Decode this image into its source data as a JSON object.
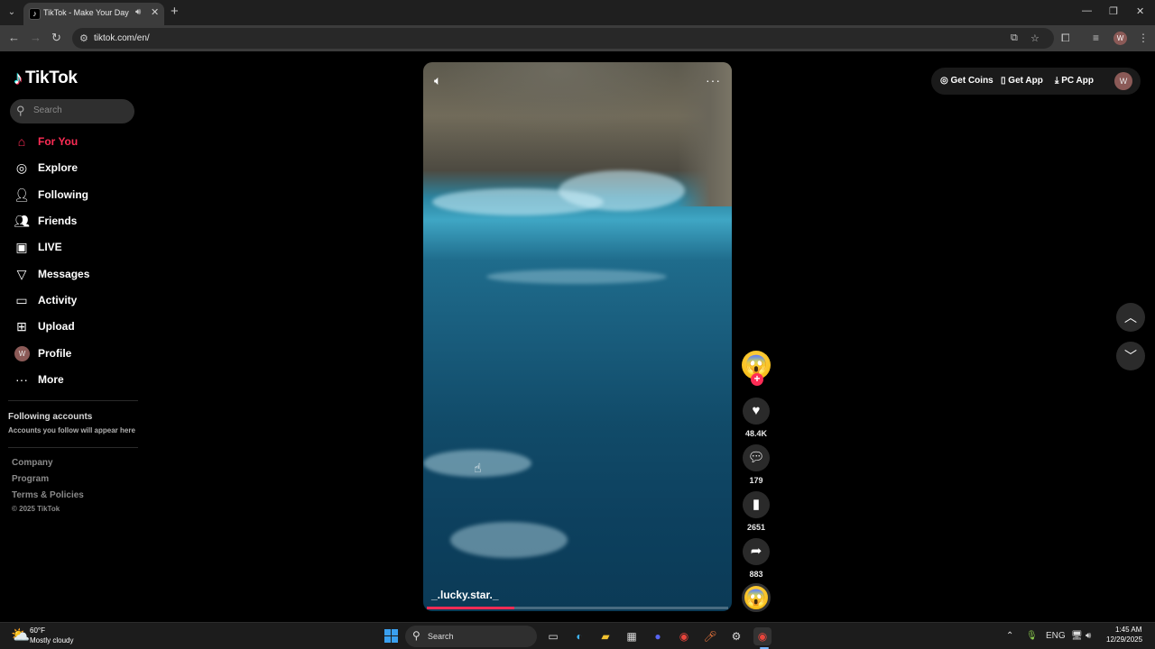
{
  "browser": {
    "tab_title": "TikTok - Make Your Day",
    "url": "tiktok.com/en/",
    "profile_initial": "W"
  },
  "sidebar": {
    "logo_text": "TikTok",
    "search_placeholder": "Search",
    "nav": [
      {
        "label": "For You",
        "icon": "home-icon",
        "active": true
      },
      {
        "label": "Explore",
        "icon": "compass-icon"
      },
      {
        "label": "Following",
        "icon": "person-follow-icon"
      },
      {
        "label": "Friends",
        "icon": "friends-icon"
      },
      {
        "label": "LIVE",
        "icon": "live-tv-icon"
      },
      {
        "label": "Messages",
        "icon": "paper-plane-icon"
      },
      {
        "label": "Activity",
        "icon": "chat-bubble-icon"
      },
      {
        "label": "Upload",
        "icon": "plus-square-icon"
      },
      {
        "label": "Profile",
        "icon": "avatar",
        "initial": "W"
      },
      {
        "label": "More",
        "icon": "ellipsis-icon"
      }
    ],
    "following_title": "Following accounts",
    "following_subtitle": "Accounts you follow will appear here",
    "footer": [
      "Company",
      "Program",
      "Terms & Policies"
    ],
    "copyright": "© 2025 TikTok"
  },
  "header": {
    "get_coins": "Get Coins",
    "get_app": "Get App",
    "pc_app": "PC App",
    "avatar_initial": "W"
  },
  "video": {
    "author": "_.lucky.star._",
    "progress": 0.29
  },
  "actions": {
    "likes": "48.4K",
    "comments": "179",
    "saves": "2651",
    "shares": "883"
  },
  "taskbar": {
    "weather_temp": "60°F",
    "weather_desc": "Mostly cloudy",
    "search_label": "Search",
    "lang": "ENG",
    "time": "1:45 AM",
    "date": "12/29/2025"
  },
  "colors": {
    "accent": "#fe2c55",
    "background": "#000000"
  }
}
